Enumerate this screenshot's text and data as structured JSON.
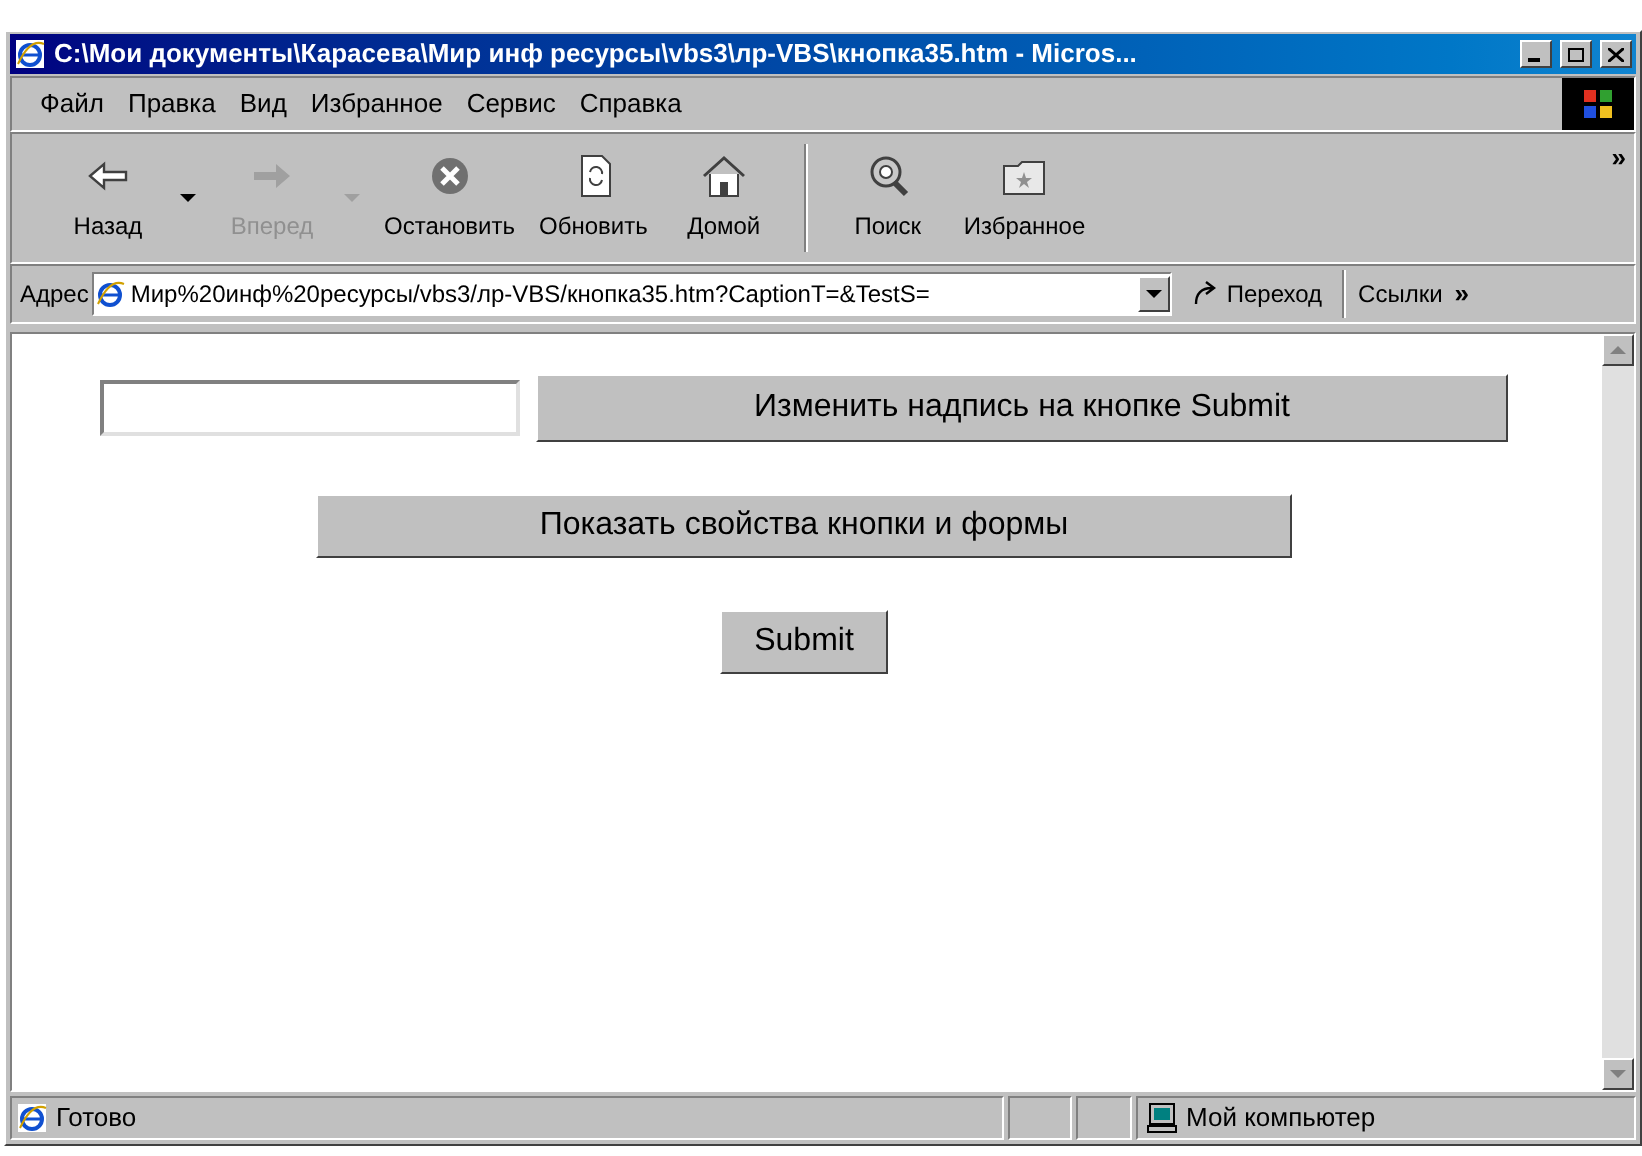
{
  "window": {
    "title": "C:\\Мои документы\\Карасева\\Мир инф ресурсы\\vbs3\\лр-VBS\\кнопка35.htm - Micros..."
  },
  "menu": [
    "Файл",
    "Правка",
    "Вид",
    "Избранное",
    "Сервис",
    "Справка"
  ],
  "toolbar": [
    {
      "kind": "back",
      "label": "Назад",
      "disabled": false,
      "dropdown": true
    },
    {
      "kind": "forward",
      "label": "Вперед",
      "disabled": true,
      "dropdown": true
    },
    {
      "kind": "stop",
      "label": "Остановить",
      "disabled": false,
      "dropdown": false
    },
    {
      "kind": "refresh",
      "label": "Обновить",
      "disabled": false,
      "dropdown": false
    },
    {
      "kind": "home",
      "label": "Домой",
      "disabled": false,
      "dropdown": false
    },
    {
      "kind": "search",
      "label": "Поиск",
      "disabled": false,
      "dropdown": false
    },
    {
      "kind": "favorites",
      "label": "Избранное",
      "disabled": false,
      "dropdown": false
    }
  ],
  "toolbar_more": "»",
  "address": {
    "label": "Адрес",
    "value": "Мир%20инф%20ресурсы/vbs3/лр-VBS/кнопка35.htm?CaptionT=&TestS=",
    "go": "Переход",
    "links": "Ссылки",
    "links_more": "»"
  },
  "page": {
    "change_button": "Изменить надпись на кнопке Submit",
    "show_button": "Показать свойства кнопки и формы",
    "submit_button": "Submit"
  },
  "status_bar": {
    "text": "Готово",
    "zone": "Мой компьютер"
  }
}
